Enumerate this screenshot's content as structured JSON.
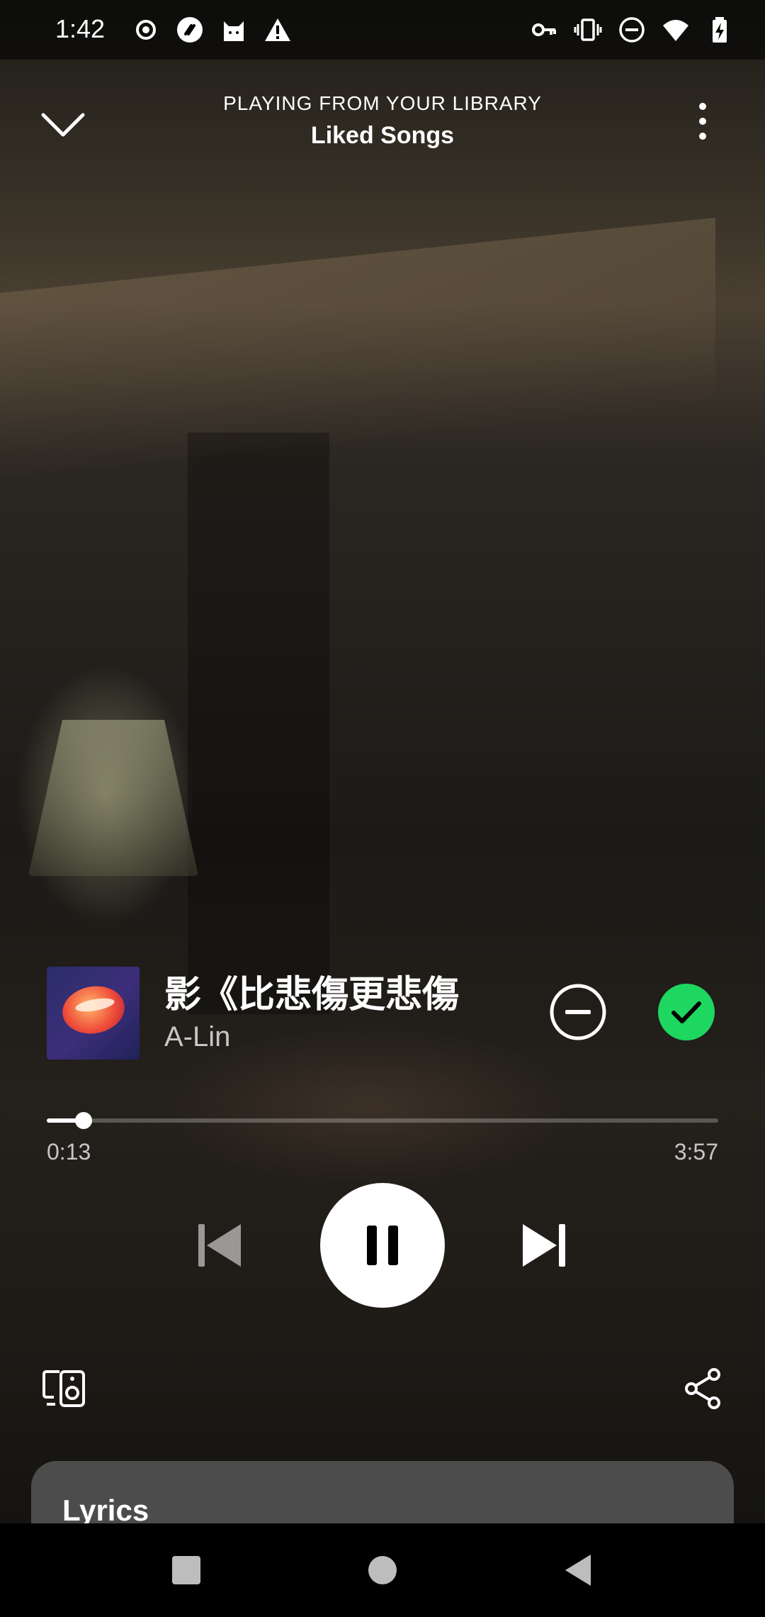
{
  "status_bar": {
    "time": "1:42",
    "left_icons": [
      "record-icon",
      "shazam-icon",
      "cat-icon",
      "warning-icon"
    ],
    "right_icons": [
      "vpn-key-icon",
      "vibrate-icon",
      "do-not-disturb-icon",
      "wifi-icon",
      "battery-charging-icon"
    ]
  },
  "header": {
    "context_label": "PLAYING FROM YOUR LIBRARY",
    "playlist_name": "Liked Songs"
  },
  "track": {
    "title": "影《比悲傷更悲傷",
    "artist": "A-Lin",
    "liked": true
  },
  "playback": {
    "elapsed": "0:13",
    "total": "3:57",
    "progress_fraction": 0.055,
    "state": "playing"
  },
  "lyrics": {
    "label": "Lyrics"
  },
  "colors": {
    "accent_green": "#1ed760",
    "lyrics_card": "#4c4c4c"
  }
}
